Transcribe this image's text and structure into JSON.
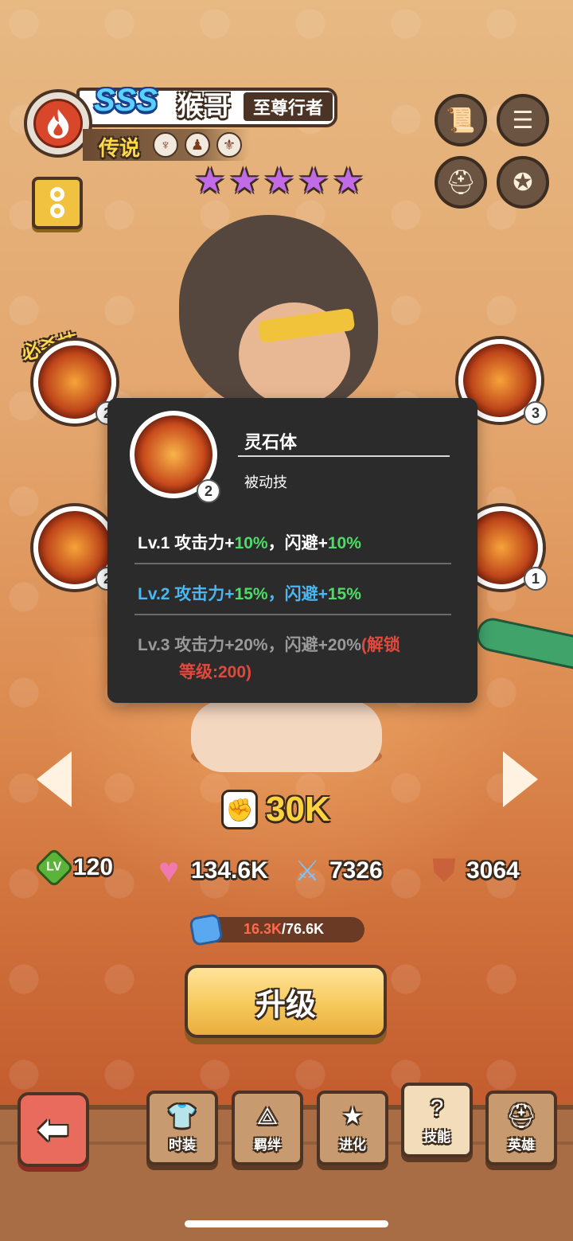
{
  "hero": {
    "rank": "SSS",
    "name": "猴哥",
    "title": "至尊行者",
    "rarity": "传说",
    "stars": 5
  },
  "icons": {
    "element": "fire-icon",
    "info": "info-icon"
  },
  "skills": {
    "ultimate_label": "必杀技",
    "right_top_level": "3",
    "right_bottom_level": "1",
    "left_top_level": "2",
    "left_bottom_level": "2"
  },
  "popup": {
    "skill_name": "灵石体",
    "skill_type": "被动技",
    "level_badge": "2",
    "levels": [
      {
        "prefix": "Lv.1 攻击力+",
        "atk": "10%",
        "mid": "，闪避+",
        "dodge": "10%"
      },
      {
        "prefix": "Lv.2 攻击力+",
        "atk": "15%",
        "mid": "，闪避+",
        "dodge": "15%"
      },
      {
        "text": "Lv.3 攻击力+20%，闪避+20%",
        "lock": "(解锁",
        "lock2": "等级:200)"
      }
    ]
  },
  "stats": {
    "power": "30K",
    "level_badge": "LV",
    "level": "120",
    "hp": "134.6K",
    "attack": "7326",
    "defense": "3064"
  },
  "exp": {
    "current": "16.3K",
    "total": "/76.6K"
  },
  "upgrade_label": "升级",
  "tabs": [
    {
      "label": "时装"
    },
    {
      "label": "羁绊"
    },
    {
      "label": "进化"
    },
    {
      "label": "技能"
    },
    {
      "label": "英雄"
    }
  ],
  "colors": {
    "accent_gold": "#ffd23f",
    "buff_green": "#4fdc66",
    "current_level_blue": "#4bb6f0",
    "locked_red": "#e04a3c",
    "star_purple": "#c26be6"
  }
}
